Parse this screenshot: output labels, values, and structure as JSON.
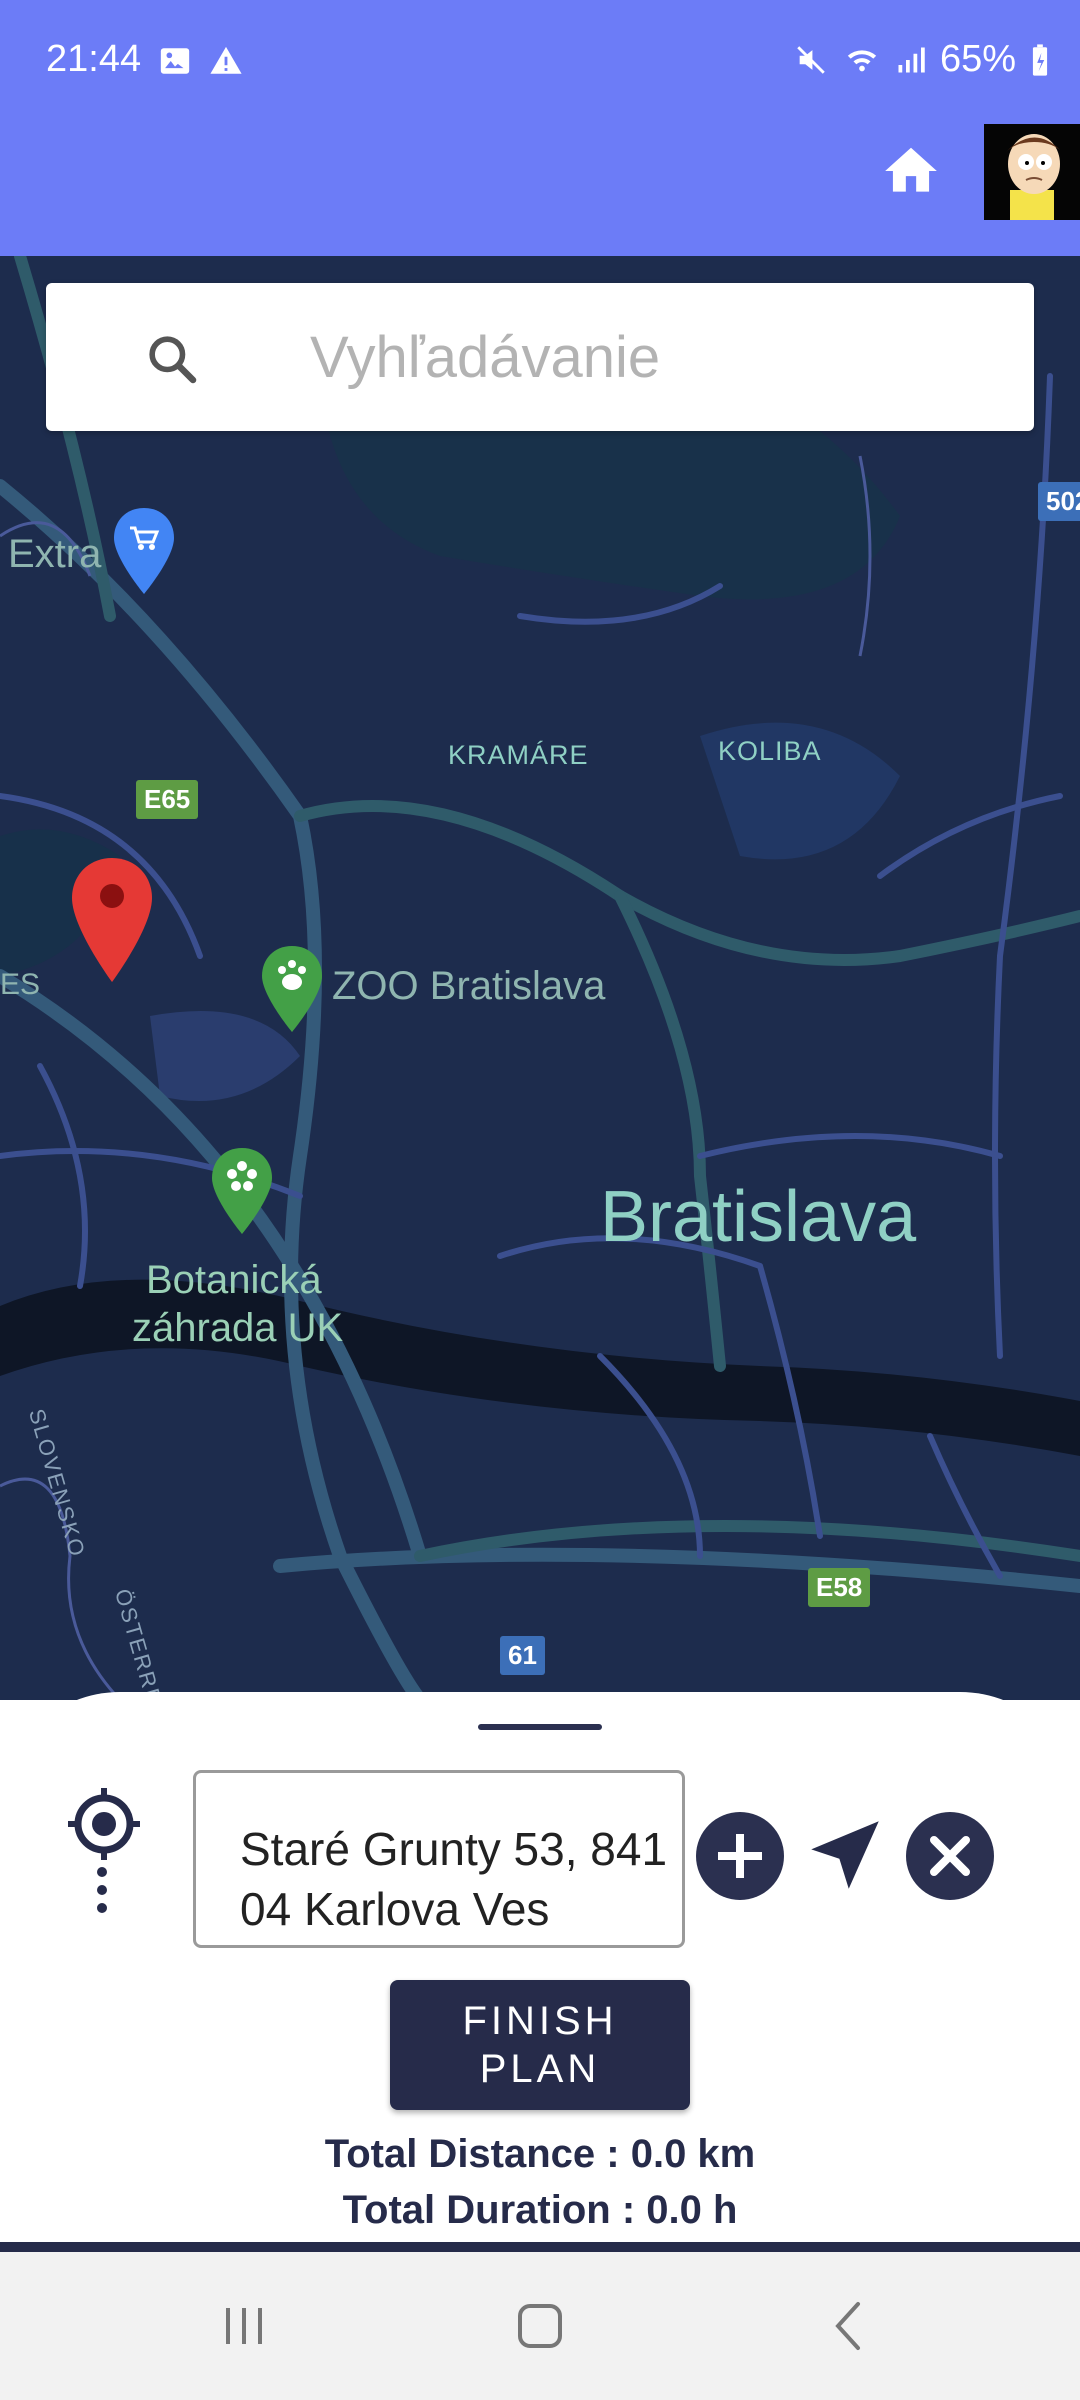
{
  "status_bar": {
    "time": "21:44",
    "battery": "65%",
    "icons_left": [
      "image-icon",
      "warning-icon"
    ],
    "icons_right": [
      "mute-icon",
      "wifi-icon",
      "signal-icon",
      "battery-charging-icon"
    ]
  },
  "header": {
    "background": "#6c7cf7",
    "home_icon": "home-icon",
    "avatar": "user-avatar"
  },
  "search": {
    "placeholder": "Vyhľadávanie"
  },
  "map": {
    "labels": {
      "extra": "Extra",
      "kramare": "KRAMÁRE",
      "koliba": "KOLIBA",
      "zoo": "ZOO Bratislava",
      "city": "Bratislava",
      "garden_line1": "Botanická",
      "garden_line2": "záhrada UK",
      "es": "ES",
      "slovensko": "SLOVENSKO",
      "osterreich": "ÖSTERREICH"
    },
    "shields": {
      "e65": "E65",
      "e58": "E58",
      "r61": "61",
      "r502": "502"
    }
  },
  "sheet": {
    "waypoint_value": "Staré Grunty 53, 841 04 Karlova Ves",
    "finish_line1": "FINISH",
    "finish_line2": "PLAN",
    "total_distance": "Total Distance : 0.0 km",
    "total_duration": "Total Duration : 0.0 h"
  },
  "colors": {
    "accent": "#6c7cf7",
    "dark": "#262b4a",
    "map_bg": "#1d2c4d",
    "marker_red": "#e53935",
    "marker_green": "#43a047",
    "marker_blue": "#4285f4"
  }
}
